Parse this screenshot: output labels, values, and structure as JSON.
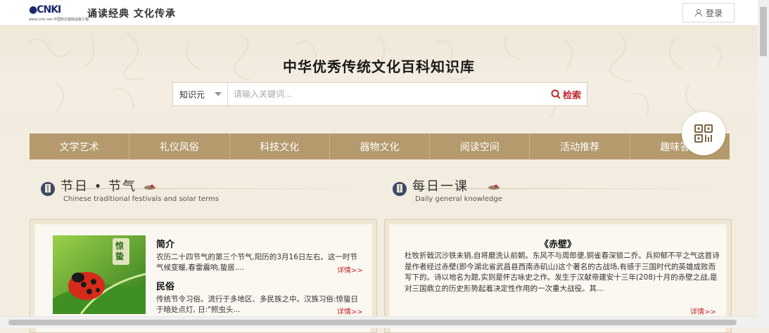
{
  "header": {
    "logo_text": "CNKI",
    "logo_url": "www.cnki.net",
    "logo_sub": "中国知识基础设施工程",
    "slogan": "诵读经典  文化传承",
    "login_label": "登录"
  },
  "hero": {
    "title": "中华优秀传统文化百科知识库",
    "search": {
      "scope": "知识元",
      "placeholder": "请输入关键词...",
      "button_label": "检索"
    }
  },
  "nav": {
    "items": [
      {
        "label": "文学艺术"
      },
      {
        "label": "礼仪风俗"
      },
      {
        "label": "科技文化"
      },
      {
        "label": "器物文化"
      },
      {
        "label": "阅读空间"
      },
      {
        "label": "活动推荐"
      },
      {
        "label": "趣味答题"
      }
    ]
  },
  "festival": {
    "title": "节日 • 节气",
    "subtitle": "Chinese traditional festivals and solar terms",
    "image_label": "惊蛰",
    "intro_heading": "简介",
    "intro_text": "农历二十四节气的第三个节气,阳历的3月16日左右。这一时节气候变暖,春雷震响,蛰居....",
    "custom_heading": "民俗",
    "custom_text": "传统节令习俗。流行于多地区、多民族之中。汉族习俗:惊蛰日于暗处点灯, 日:\"照虫头...",
    "more_label": "详情>>"
  },
  "daily": {
    "title": "每日一课",
    "subtitle": "Daily general knowledge",
    "poem_title": "《赤壁》",
    "poem_text": "杜牧折戟沉沙铁未销,自将磨洗认前朝。东风不与周郎便,铜雀春深锁二乔。兵抑郁不平之气这首诗是作者经过赤壁(即今湖北省武昌县西南赤矶山)这个著名的古战场,有感于三国时代的英雄成败而写下的。诗以地名为题,实则是怀古咏史之作。发生于汉献帝建安十三年(208)十月的赤壁之战,是对三国鼎立的历史形势起着决定性作用的一次重大战役。其...",
    "more_label": "详情>>"
  },
  "colors": {
    "nav_bg": "#b49a6c",
    "accent_red": "#c0282a",
    "page_bg": "#f3ece0"
  }
}
